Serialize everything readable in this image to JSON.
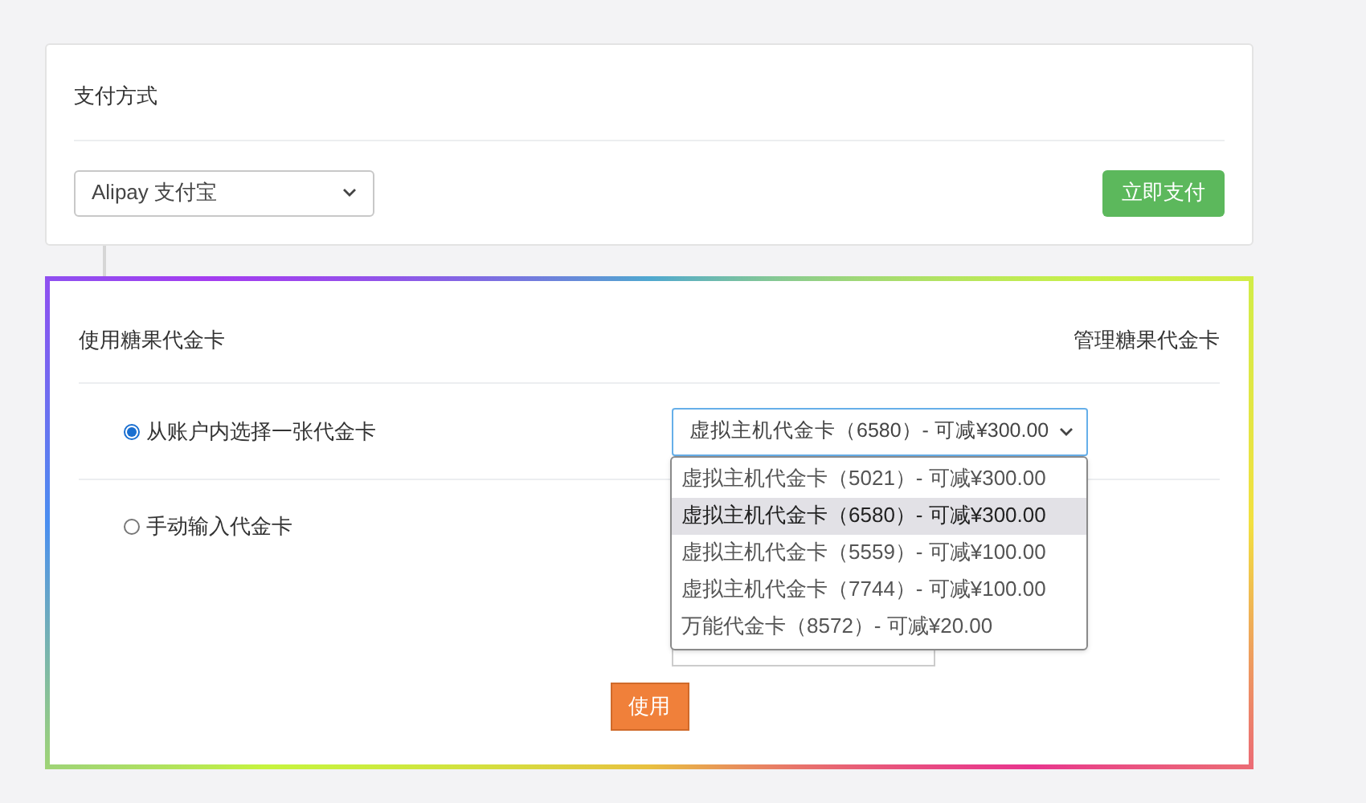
{
  "payment": {
    "title": "支付方式",
    "method_select": {
      "value": "Alipay 支付宝"
    },
    "pay_button": "立即支付"
  },
  "voucher": {
    "title": "使用糖果代金卡",
    "manage_link": "管理糖果代金卡",
    "options": [
      {
        "label": "从账户内选择一张代金卡",
        "selected": true
      },
      {
        "label": "手动输入代金卡",
        "selected": false
      }
    ],
    "card_select": {
      "value": "虚拟主机代金卡（6580）- 可减¥300.00",
      "open": true
    },
    "dropdown": [
      {
        "label": "虚拟主机代金卡（5021）- 可减¥300.00",
        "selected": false
      },
      {
        "label": "虚拟主机代金卡（6580）- 可减¥300.00",
        "selected": true
      },
      {
        "label": "虚拟主机代金卡（5559）- 可减¥100.00",
        "selected": false
      },
      {
        "label": "虚拟主机代金卡（7744）- 可减¥100.00",
        "selected": false
      },
      {
        "label": "万能代金卡（8572）- 可减¥20.00",
        "selected": false
      }
    ],
    "use_button": "使用"
  }
}
